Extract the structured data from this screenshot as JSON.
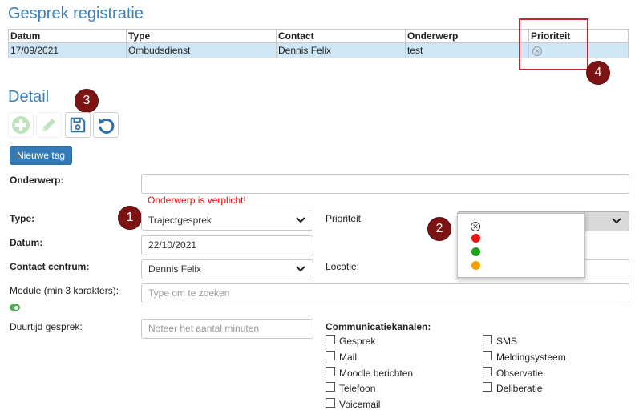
{
  "registratie": {
    "title": "Gesprek registratie",
    "columns": [
      "Datum",
      "Type",
      "Contact",
      "Onderwerp",
      "Prioriteit"
    ],
    "rows": [
      {
        "datum": "17/09/2021",
        "type": "Ombudsdienst",
        "contact": "Dennis Felix",
        "onderwerp": "test",
        "prioriteit_icon": "x-circle-icon"
      }
    ]
  },
  "badges": {
    "b1": "1",
    "b2": "2",
    "b3": "3",
    "b4": "4"
  },
  "detail": {
    "title": "Detail",
    "toolbar": {
      "add_icon": "plus-circle-icon",
      "edit_icon": "pencil-icon",
      "save_icon": "floppy-disk-icon",
      "undo_icon": "undo-icon"
    },
    "new_tag_label": "Nieuwe tag",
    "onderwerp": {
      "label": "Onderwerp:",
      "value": "",
      "error": "Onderwerp is verplicht!"
    },
    "type": {
      "label": "Type:",
      "value": "Trajectgesprek"
    },
    "prioriteit": {
      "label": "Prioriteit",
      "options": [
        {
          "icon": "x-circle-icon",
          "color": ""
        },
        {
          "icon": "red-dot",
          "color": "#ee1111"
        },
        {
          "icon": "green-dot",
          "color": "#1aa51a"
        },
        {
          "icon": "orange-dot",
          "color": "#f5a000"
        }
      ]
    },
    "datum": {
      "label": "Datum:",
      "value": "22/10/2021"
    },
    "contact_centrum": {
      "label": "Contact centrum:",
      "value": "Dennis Felix"
    },
    "locatie": {
      "label": "Locatie:",
      "value": ""
    },
    "module": {
      "label": "Module (min 3 karakters):",
      "placeholder": "Type om te zoeken"
    },
    "duurtijd": {
      "label": "Duurtijd gesprek:",
      "placeholder": "Noteer het aantal minuten"
    },
    "communicatiekanalen": {
      "label": "Communicatiekanalen:",
      "left": [
        "Gesprek",
        "Mail",
        "Moodle berichten",
        "Telefoon",
        "Voicemail"
      ],
      "right": [
        "SMS",
        "Meldingsysteem",
        "Observatie",
        "Deliberatie"
      ]
    }
  },
  "colors": {
    "title_blue": "#3f7fb8",
    "row_highlight": "#cfe6f6",
    "primary_button": "#337ab7",
    "error_red": "#e01010",
    "badge_red": "#7d1414",
    "annotation_border": "#c0282e"
  }
}
